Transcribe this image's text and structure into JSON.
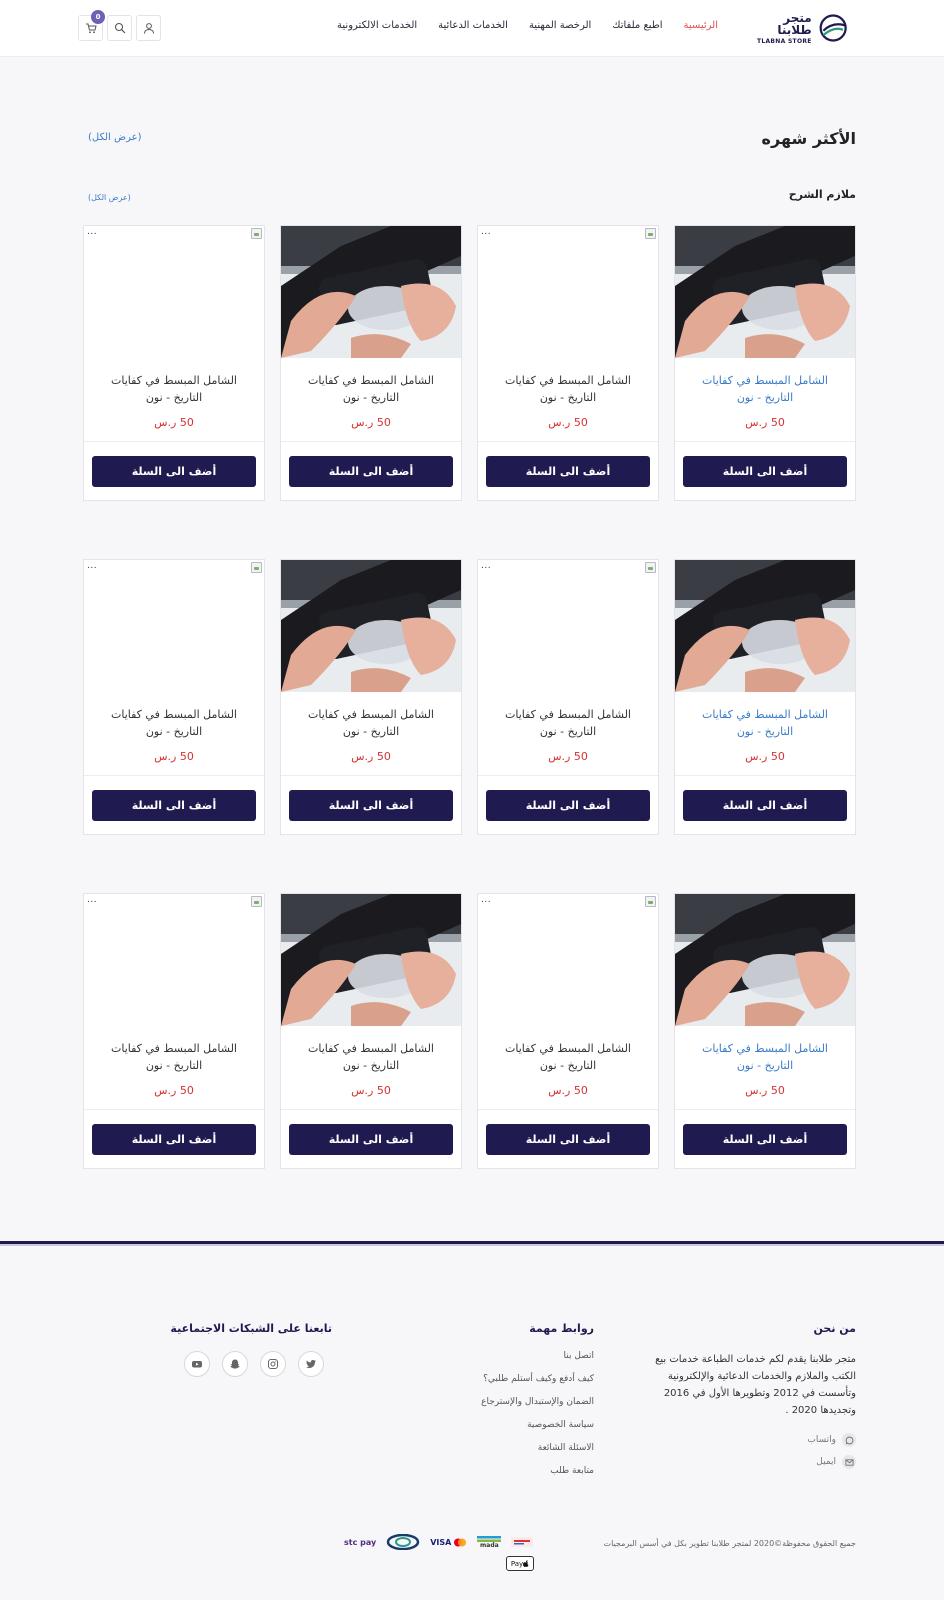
{
  "header": {
    "logo_ar": "متجر طلابنا",
    "logo_en": "TLABNA STORE",
    "nav": [
      {
        "label": "الرئيسية",
        "active": true
      },
      {
        "label": "اطبع ملفاتك",
        "active": false
      },
      {
        "label": "الرخصة المهنية",
        "active": false
      },
      {
        "label": "الخدمات الدعائية",
        "active": false
      },
      {
        "label": "الخدمات الالكترونية",
        "active": false
      }
    ],
    "cart_count": "0"
  },
  "section": {
    "title": "الأكثر شهره",
    "view_all": "(عرض الكل)",
    "subtitle": "ملازم الشرح",
    "sub_view_all": "(عرض الكل)"
  },
  "products": [
    {
      "name": "الشامل المبسط في كفايات التاريخ - نون",
      "price": "50 ر.س",
      "button": "أضف الى السلة",
      "image": "photo"
    },
    {
      "name": "الشامل المبسط في كفايات التاريخ - نون",
      "price": "50 ر.س",
      "button": "أضف الى السلة",
      "image": "broken"
    },
    {
      "name": "الشامل المبسط في كفايات التاريخ - نون",
      "price": "50 ر.س",
      "button": "أضف الى السلة",
      "image": "photo"
    },
    {
      "name": "الشامل المبسط في كفايات التاريخ - نون",
      "price": "50 ر.س",
      "button": "أضف الى السلة",
      "image": "broken"
    },
    {
      "name": "الشامل المبسط في كفايات التاريخ - نون",
      "price": "50 ر.س",
      "button": "أضف الى السلة",
      "image": "photo"
    },
    {
      "name": "الشامل المبسط في كفايات التاريخ - نون",
      "price": "50 ر.س",
      "button": "أضف الى السلة",
      "image": "broken"
    },
    {
      "name": "الشامل المبسط في كفايات التاريخ - نون",
      "price": "50 ر.س",
      "button": "أضف الى السلة",
      "image": "photo"
    },
    {
      "name": "الشامل المبسط في كفايات التاريخ - نون",
      "price": "50 ر.س",
      "button": "أضف الى السلة",
      "image": "broken"
    },
    {
      "name": "الشامل المبسط في كفايات التاريخ - نون",
      "price": "50 ر.س",
      "button": "أضف الى السلة",
      "image": "photo"
    },
    {
      "name": "الشامل المبسط في كفايات التاريخ - نون",
      "price": "50 ر.س",
      "button": "أضف الى السلة",
      "image": "broken"
    },
    {
      "name": "الشامل المبسط في كفايات التاريخ - نون",
      "price": "50 ر.س",
      "button": "أضف الى السلة",
      "image": "photo"
    },
    {
      "name": "الشامل المبسط في كفايات التاريخ - نون",
      "price": "50 ر.س",
      "button": "أضف الى السلة",
      "image": "broken"
    }
  ],
  "broken_image_text": "...",
  "footer": {
    "about_title": "من نحن",
    "about_text": "متجر طلابنا يقدم لكم خدمات الطباعة خدمات بيع الكتب والملازم والخدمات الدعائية والإلكترونية وتأسست في 2012 وتطويرها الأول في 2016 وتجديدها 2020 .",
    "whatsapp": "واتساب",
    "email": "ايميل",
    "links_title": "روابط مهمة",
    "links": [
      "اتصل بنا",
      "كيف أدفع وكيف أستلم طلبي؟",
      "الضمان والإستبدال والإسترجاع",
      "سياسة الخصوصية",
      "الاسئلة الشائعة",
      "متابعة طلب"
    ],
    "social_title": "تابعنا على الشبكات الاجتماعية",
    "social": [
      "twitter-icon",
      "instagram-icon",
      "snapchat-icon",
      "youtube-icon"
    ],
    "copyright": "جميع الحقوق محفوظة©2020 لمتجر طلابنا تطوير بكل في أسس البرمجيات",
    "payments": [
      "stc pay",
      "VISA",
      "mada",
      "Pay"
    ]
  },
  "colors": {
    "brand": "#1f1a4f",
    "accent_red": "#d63232",
    "link_blue": "#3a7bc8",
    "badge": "#6f5fb7"
  }
}
